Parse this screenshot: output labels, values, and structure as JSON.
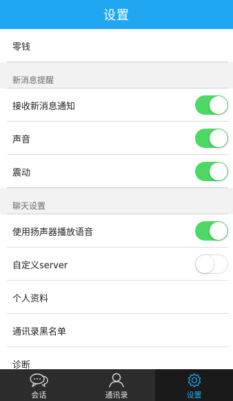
{
  "header": {
    "title": "设置"
  },
  "rows": {
    "wallet": "零钱",
    "section_notify": "新消息提醒",
    "receive_notify": "接收新消息通知",
    "sound": "声音",
    "vibrate": "震动",
    "section_chat": "聊天设置",
    "speaker": "使用扬声器播放语音",
    "custom_server": "自定义server",
    "profile": "个人资料",
    "blacklist": "通讯录黑名单",
    "diagnose": "诊断"
  },
  "toggles": {
    "receive_notify": true,
    "sound": true,
    "vibrate": true,
    "speaker": true,
    "custom_server": false
  },
  "tabs": [
    {
      "label": "会话",
      "icon": "chat-bubbles-icon",
      "active": false
    },
    {
      "label": "通讯录",
      "icon": "person-icon",
      "active": false
    },
    {
      "label": "设置",
      "icon": "gear-icon",
      "active": true
    }
  ],
  "colors": {
    "header_bg": "#1fa8f1",
    "toggle_on": "#4cd964",
    "tabbar_bg": "#2c2c2c",
    "tab_active": "#1fa8f1"
  }
}
